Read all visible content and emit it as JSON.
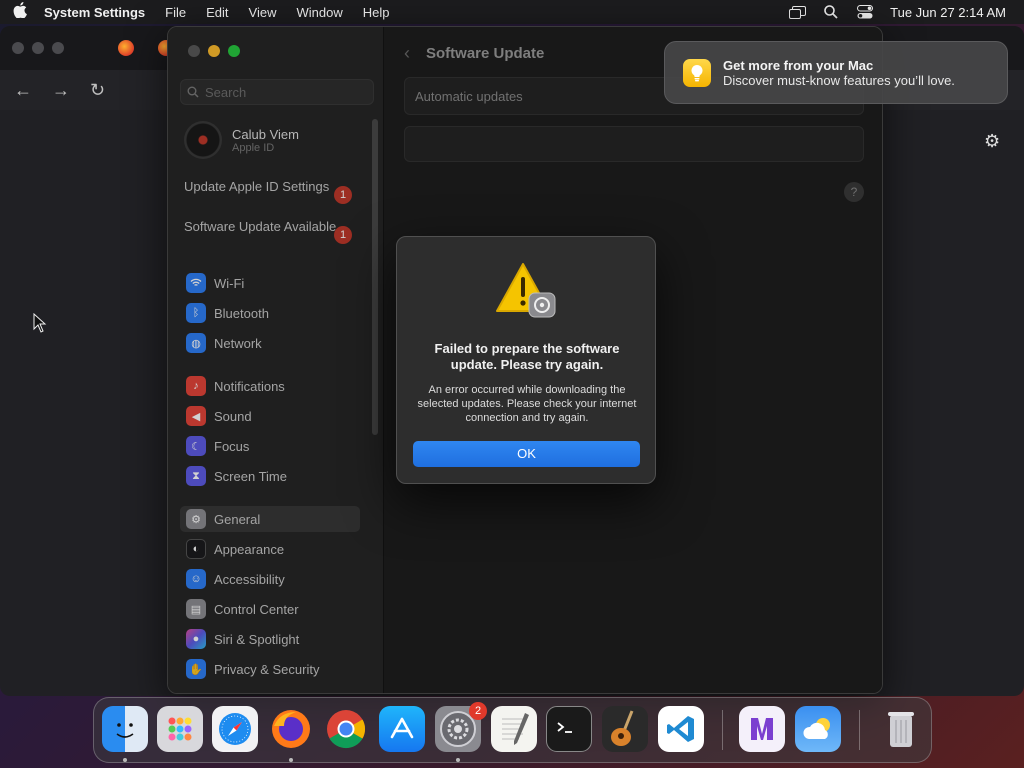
{
  "menubar": {
    "app_name": "System Settings",
    "menus": [
      "File",
      "Edit",
      "View",
      "Window",
      "Help"
    ],
    "datetime": "Tue Jun 27  2:14 AM"
  },
  "settings": {
    "search_placeholder": "Search",
    "account": {
      "name": "Calub Viem",
      "subtitle": "Apple ID"
    },
    "alerts": [
      {
        "label": "Update Apple ID Settings",
        "badge": "1"
      },
      {
        "label": "Software Update Available",
        "badge": "1"
      }
    ],
    "sidebar_items": [
      {
        "label": "Wi-Fi",
        "icon": "wifi-icon",
        "color": "#2f7ff6"
      },
      {
        "label": "Bluetooth",
        "icon": "bluetooth-icon",
        "color": "#2f7ff6"
      },
      {
        "label": "Network",
        "icon": "globe-icon",
        "color": "#2f7ff6"
      },
      {
        "label": "Notifications",
        "icon": "bell-icon",
        "color": "#e5453a"
      },
      {
        "label": "Sound",
        "icon": "speaker-icon",
        "color": "#e5453a"
      },
      {
        "label": "Focus",
        "icon": "moon-icon",
        "color": "#5e5ce6"
      },
      {
        "label": "Screen Time",
        "icon": "hourglass-icon",
        "color": "#5e5ce6"
      },
      {
        "label": "General",
        "icon": "gear-icon",
        "color": "#8e8e93"
      },
      {
        "label": "Appearance",
        "icon": "appearance-icon",
        "color": "#1c1c1e"
      },
      {
        "label": "Accessibility",
        "icon": "accessibility-icon",
        "color": "#2f7ff6"
      },
      {
        "label": "Control Center",
        "icon": "control-center-icon",
        "color": "#8e8e93"
      },
      {
        "label": "Siri & Spotlight",
        "icon": "siri-icon",
        "color": "#c04fd8"
      },
      {
        "label": "Privacy & Security",
        "icon": "hand-icon",
        "color": "#2f7ff6"
      }
    ],
    "content_title": "Software Update",
    "automatic_updates_label": "Automatic updates",
    "help_label": "?"
  },
  "dialog": {
    "title": "Failed to prepare the software update. Please try again.",
    "message": "An error occurred while downloading the selected updates. Please check your internet connection and try again.",
    "ok_label": "OK"
  },
  "notification": {
    "title": "Get more from your Mac",
    "body": "Discover must-know features you’ll love."
  },
  "dock": {
    "apps": [
      "Finder",
      "Launchpad",
      "Safari",
      "Firefox",
      "Chrome",
      "App Store",
      "System Settings",
      "TextEdit",
      "Terminal",
      "GarageBand",
      "Visual Studio Code",
      "Visual Studio",
      "Weather",
      "Trash"
    ],
    "system_settings_badge": "2"
  }
}
